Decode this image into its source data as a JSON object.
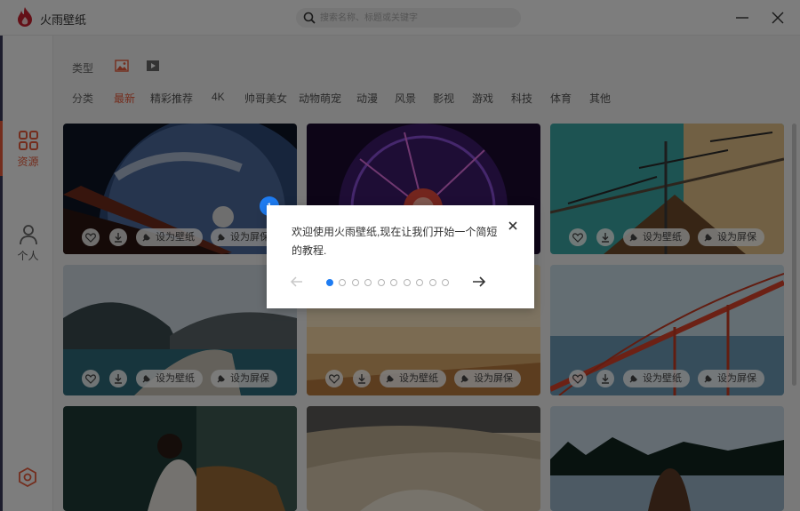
{
  "titlebar": {
    "app_title": "火雨壁纸",
    "search_placeholder": "搜索名称、标题或关键字",
    "logo_icon": "flame-logo-icon",
    "search_icon": "search-icon",
    "minimize_icon": "minimize-icon",
    "close_icon": "close-icon"
  },
  "leftnav": {
    "items": [
      {
        "label": "资源",
        "icon": "grid-icon",
        "active": true
      },
      {
        "label": "个人",
        "icon": "person-icon",
        "active": false
      }
    ],
    "settings_icon": "settings-icon"
  },
  "filters": {
    "type_label": "类型",
    "type_icons": [
      "image-icon",
      "video-icon"
    ],
    "category_label": "分类",
    "categories": [
      "最新",
      "精彩推荐",
      "4K",
      "帅哥美女",
      "动物萌宠",
      "动漫",
      "风景",
      "影视",
      "游戏",
      "科技",
      "体育",
      "其他"
    ],
    "active_category": "最新"
  },
  "cards": {
    "actions": {
      "favorite_icon": "heart-icon",
      "download_icon": "download-icon",
      "set_wallpaper": "设为壁纸",
      "set_screensaver": "设为屏保",
      "action_icon": "wrench-icon"
    },
    "items": [
      {
        "subject": "earth-astronaut"
      },
      {
        "subject": "plasma-ball"
      },
      {
        "subject": "construction-cranes"
      },
      {
        "subject": "mountain-lake"
      },
      {
        "subject": "desert-sunrise"
      },
      {
        "subject": "red-bridge"
      },
      {
        "subject": "woman-reading"
      },
      {
        "subject": "sand-dunes"
      },
      {
        "subject": "lake-forest"
      }
    ]
  },
  "colors": {
    "accent": "#e85a3b",
    "tutorial_blue": "#1e7cf2"
  },
  "tutorial": {
    "step": "1",
    "text": "欢迎使用火雨壁纸,现在让我们开始一个简短的教程.",
    "total_steps": 10,
    "current_step": 1,
    "prev_icon": "arrow-left-icon",
    "next_icon": "arrow-right-icon",
    "close_icon": "close-icon"
  }
}
